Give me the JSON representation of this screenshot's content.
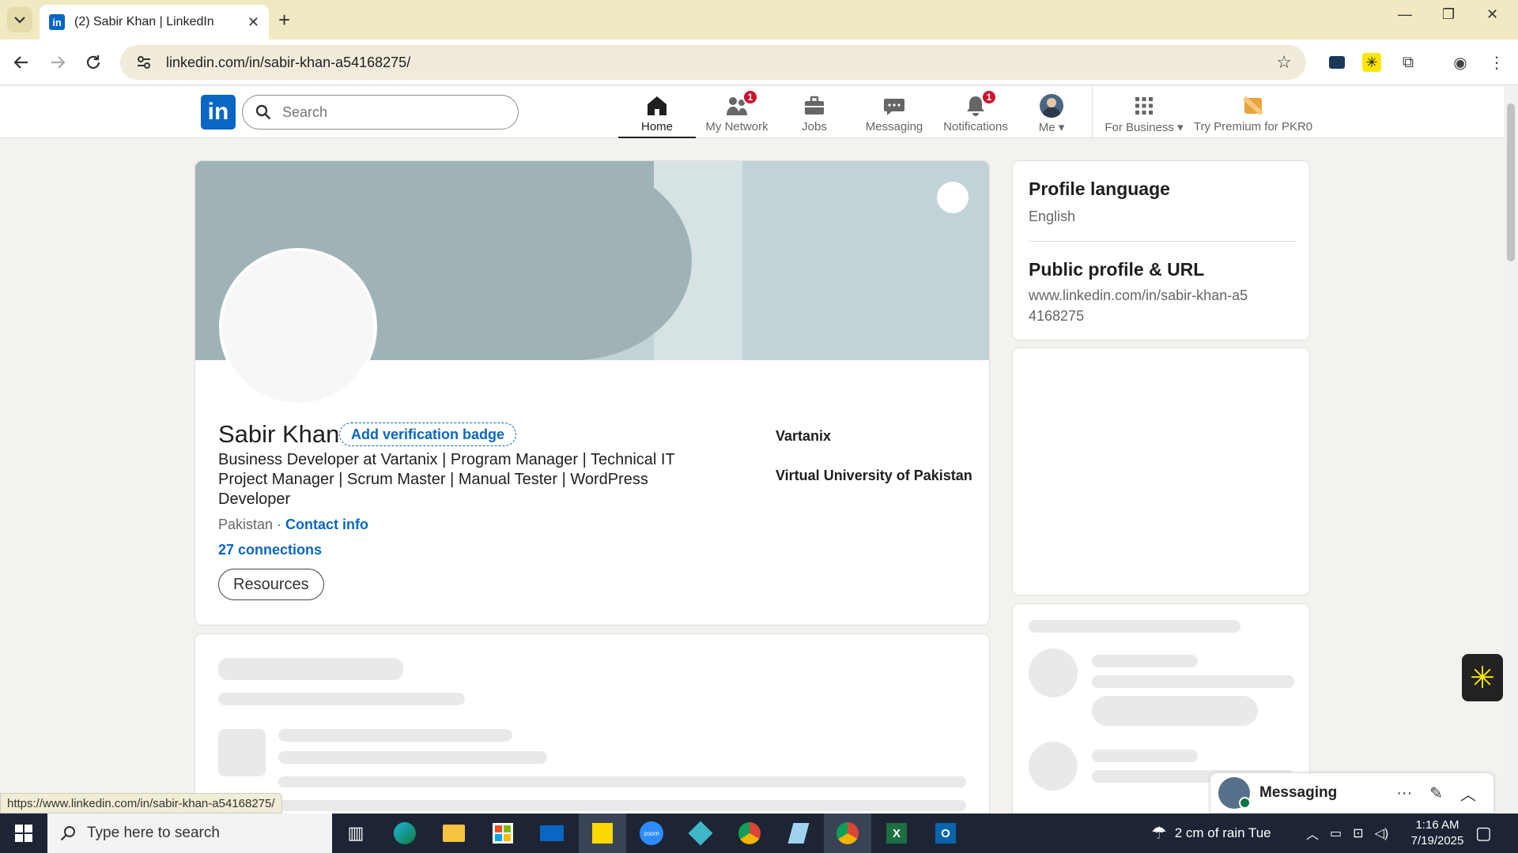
{
  "browser": {
    "tab_title": "(2) Sabir Khan | LinkedIn",
    "url": "linkedin.com/in/sabir-khan-a54168275/",
    "status_url": "https://www.linkedin.com/in/sabir-khan-a54168275/"
  },
  "linkedin": {
    "logo": "in",
    "search_placeholder": "Search",
    "nav": [
      {
        "label": "Home",
        "icon": "home-icon"
      },
      {
        "label": "My Network",
        "icon": "network-icon",
        "badge": "1"
      },
      {
        "label": "Jobs",
        "icon": "briefcase-icon"
      },
      {
        "label": "Messaging",
        "icon": "chat-icon"
      },
      {
        "label": "Notifications",
        "icon": "bell-icon",
        "badge": "1"
      },
      {
        "label": "Me",
        "icon": "avatar"
      },
      {
        "label": "For Business",
        "icon": "grid-icon"
      },
      {
        "label": "Try Premium for PKR0",
        "icon": "premium-icon"
      }
    ]
  },
  "profile": {
    "name": "Sabir Khan",
    "verification_button": "Add verification badge",
    "headline": "Business Developer at Vartanix | Program Manager | Technical IT Project Manager | Scrum Master | Manual Tester | WordPress Developer",
    "location": "Pakistan",
    "separator": " · ",
    "contact_info": "Contact info",
    "connections": "27 connections",
    "resources_button": "Resources",
    "company": "Vartanix",
    "education": "Virtual University of Pakistan"
  },
  "right_rail": {
    "profile_language_title": "Profile language",
    "profile_language_value": "English",
    "public_profile_title": "Public profile & URL",
    "public_profile_url": "www.linkedin.com/in/sabir-khan-a54168275"
  },
  "messaging": {
    "title": "Messaging"
  },
  "taskbar": {
    "search_placeholder": "Type here to search",
    "weather": "2 cm of rain Tue",
    "time": "1:16 AM",
    "date": "7/19/2025"
  },
  "colors": {
    "linkedin_blue": "#0a66c2",
    "badge_red": "#cb112d",
    "banner_left": "#9fb3b6",
    "banner_right": "#c1d3d6",
    "tabbar": "#f1e9c2"
  }
}
